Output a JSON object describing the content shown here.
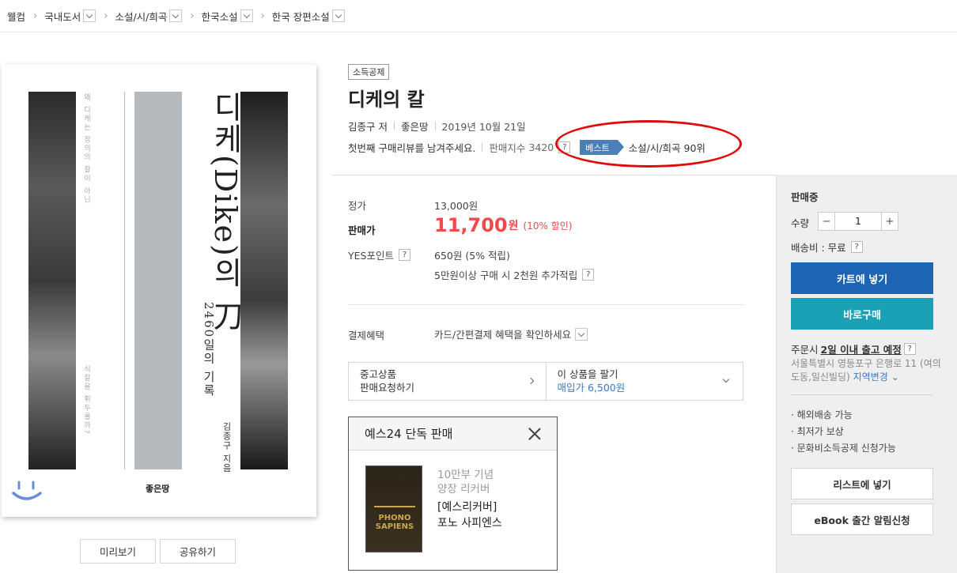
{
  "breadcrumb": {
    "home": "웰컴",
    "items": [
      {
        "label": "국내도서"
      },
      {
        "label": "소설/시/희곡"
      },
      {
        "label": "한국소설"
      },
      {
        "label": "한국 장편소설"
      }
    ]
  },
  "cover": {
    "title": "디케(Dike)의 刀",
    "subtitle": "2460일의 기록",
    "tagline": "왜 디케는 정의의 칼이 아닌",
    "tagline2": "식칼을 휘두를까?",
    "author_text": "김종구 지음",
    "publisher_text": "좋은땅",
    "preview_label": "미리보기",
    "share_label": "공유하기"
  },
  "product": {
    "tag": "소득공제",
    "title": "디케의 칼",
    "author": "김종구",
    "author_role": "저",
    "publisher": "좋은땅",
    "date": "2019년 10월 21일",
    "review_prompt": "첫번째 구매리뷰를 남겨주세요.",
    "sales_index_label": "판매지수",
    "sales_index": "3420",
    "best_label": "베스트",
    "best_rank": "소설/시/희곡 90위"
  },
  "price": {
    "list_label": "정가",
    "list_value": "13,000원",
    "sale_label": "판매가",
    "sale_value": "11,700",
    "sale_unit": "원",
    "discount": "(10% 할인)",
    "points_label": "YES포인트",
    "points_value": "650원 (5% 적립)",
    "bonus_text": "5만원이상 구매 시 2천원 추가적립",
    "payment_label": "결제혜택",
    "payment_value": "카드/간편결제 혜택을 확인하세요"
  },
  "used": {
    "left_line1": "중고상품",
    "left_line2": "판매요청하기",
    "right_line1": "이 상품을 팔기",
    "right_line2": "매입가 6,500원"
  },
  "popup": {
    "header": "예스24 단독 판매",
    "line1": "10만부 기념",
    "line2": "양장 리커버",
    "line3": "[예스리커버]",
    "line4": "포노 사피엔스",
    "mini_cover_title": "PHONO SAPIENS"
  },
  "panel": {
    "status": "판매중",
    "qty_label": "수량",
    "qty_value": "1",
    "minus": "−",
    "plus": "+",
    "shipping_label": "배송비 : 무료",
    "cart_label": "카트에 넣기",
    "buy_label": "바로구매",
    "order_prefix": "주문시",
    "order_eta": "2일 이내 출고 예정",
    "address": "서울특별시 영등포구 은행로 11 (여의도동,일신빌딩)",
    "region_change": "지역변경",
    "bullets": [
      "· 해외배송 가능",
      "· 최저가 보상",
      "· 문화비소득공제 신청가능"
    ],
    "wishlist_label": "리스트에 넣기",
    "ebook_label": "eBook 출간 알림신청"
  },
  "colors": {
    "sale_red": "#f04b4b",
    "cart_blue": "#1e64b4",
    "buy_teal": "#1aa1b5",
    "best_blue": "#4a7fb8",
    "annotation_red": "#e10b0b"
  }
}
